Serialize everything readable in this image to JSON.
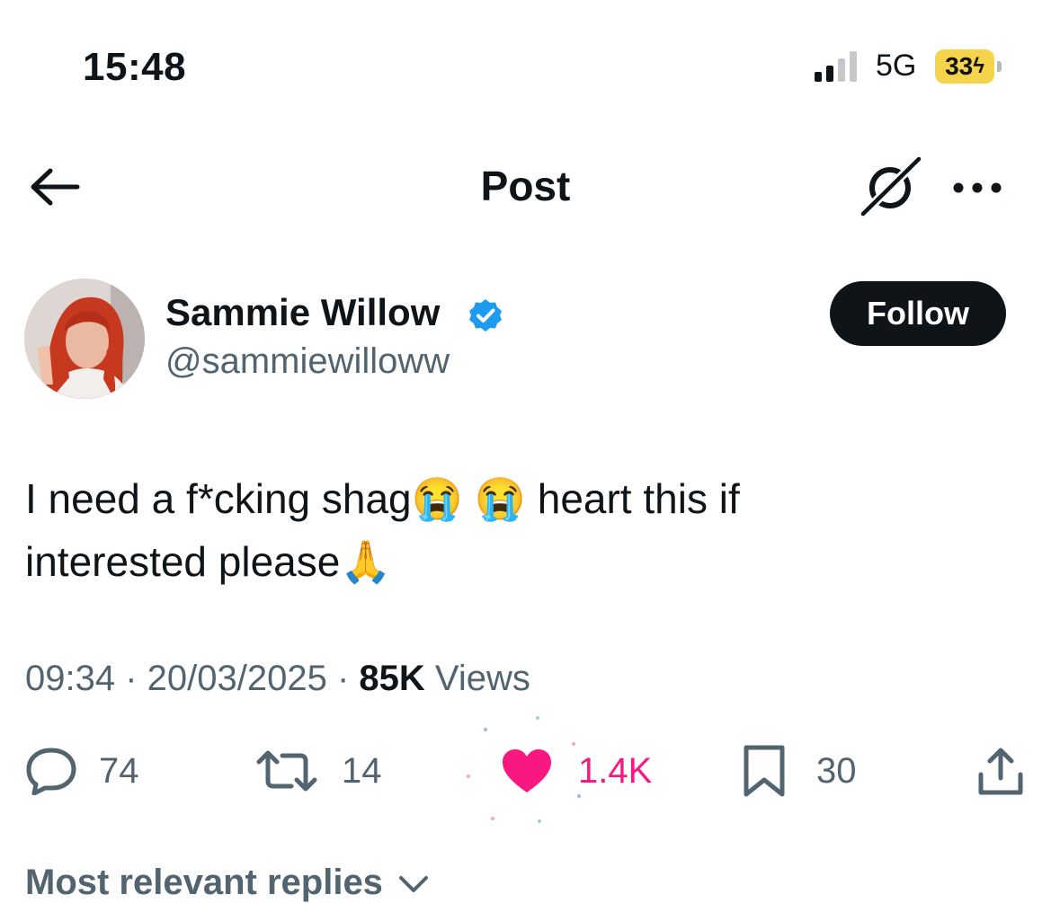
{
  "status_bar": {
    "time": "15:48",
    "network": "5G",
    "battery": "33",
    "battery_color": "#f5d34a"
  },
  "header": {
    "title": "Post",
    "back_icon": "arrow-left-icon",
    "grok_icon": "grok-icon",
    "more_icon": "more-dots-icon"
  },
  "author": {
    "display_name": "Sammie Willow",
    "handle": "@sammiewilloww",
    "verified": true,
    "follow_label": "Follow"
  },
  "post": {
    "text_line1": "I need a f*cking shag😭 😭 heart this if",
    "text_line2": "interested please🙏",
    "time": "09:34",
    "date": "20/03/2025",
    "separator": " · ",
    "views_count": "85K",
    "views_label": " Views"
  },
  "actions": {
    "replies": "74",
    "reposts": "14",
    "likes": "1.4K",
    "bookmarks": "30",
    "liked": true,
    "like_color": "#f91880"
  },
  "replies_section": {
    "label": "Most relevant replies"
  },
  "colors": {
    "text": "#0f1419",
    "secondary": "#536471",
    "verified": "#1d9bf0"
  }
}
